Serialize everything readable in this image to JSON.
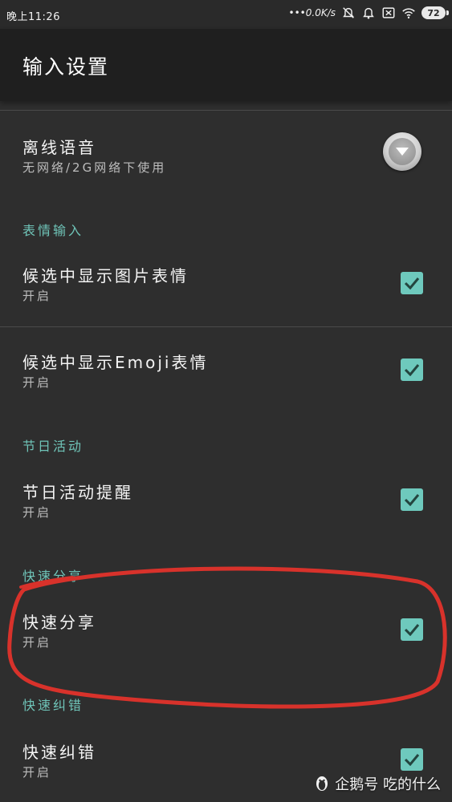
{
  "status_bar": {
    "time": "晚上11:26",
    "net_speed": "•••0.0K/s",
    "battery": "72",
    "icons": [
      "alarm-off-icon",
      "bell-icon",
      "close-box-icon",
      "wifi-icon",
      "battery-icon"
    ]
  },
  "header": {
    "title": "输入设置"
  },
  "settings": {
    "offline_voice": {
      "label": "离线语音",
      "sub": "无网络/2G网络下使用",
      "control": "dropdown"
    },
    "sections": [
      {
        "header": "表情输入",
        "items": [
          {
            "label": "候选中显示图片表情",
            "sub": "开启",
            "checked": true
          },
          {
            "label": "候选中显示Emoji表情",
            "sub": "开启",
            "checked": true
          }
        ]
      },
      {
        "header": "节日活动",
        "items": [
          {
            "label": "节日活动提醒",
            "sub": "开启",
            "checked": true
          }
        ]
      },
      {
        "header": "快速分享",
        "items": [
          {
            "label": "快速分享",
            "sub": "开启",
            "checked": true
          }
        ]
      },
      {
        "header": "快速纠错",
        "items": [
          {
            "label": "快速纠错",
            "sub": "开启",
            "checked": true
          }
        ]
      }
    ]
  },
  "watermark": {
    "text": "企鹅号 吃的什么"
  },
  "colors": {
    "background": "#2e2e2e",
    "title_bar": "#1f1f1f",
    "accent_teal": "#6ec9bd",
    "section_header": "#6fc4b8",
    "annotation_red": "#d8322b"
  }
}
